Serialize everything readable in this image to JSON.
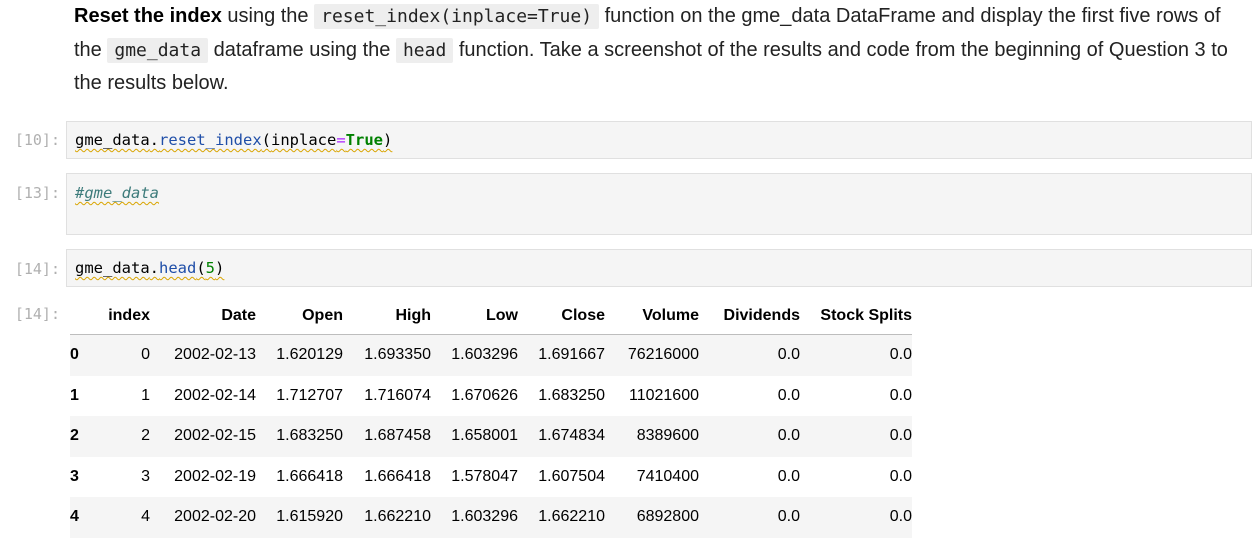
{
  "markdown": {
    "bold": "Reset the index",
    "t1": " using the ",
    "code1": "reset_index(inplace=True)",
    "t2": " function on the gme_data DataFrame and display the first five rows of the ",
    "code2": "gme_data",
    "t3": " dataframe using the ",
    "code3": "head",
    "t4": " function. Take a screenshot of the results and code from the beginning of Question 3 to the results below."
  },
  "cells": [
    {
      "prompt": "[10]:",
      "tokens": {
        "obj": "gme_data",
        "dot": ".",
        "method": "reset_index",
        "open": "(",
        "param": "inplace",
        "eq": "=",
        "value": "True",
        "close": ")"
      }
    },
    {
      "prompt": "[13]:",
      "comment": "#gme_data"
    },
    {
      "prompt": "[14]:",
      "tokens": {
        "obj": "gme_data",
        "dot": ".",
        "method": "head",
        "open": "(",
        "arg": "5",
        "close": ")"
      }
    }
  ],
  "output": {
    "prompt": "[14]:",
    "columns": [
      "",
      "index",
      "Date",
      "Open",
      "High",
      "Low",
      "Close",
      "Volume",
      "Dividends",
      "Stock Splits"
    ],
    "rows": [
      [
        "0",
        "0",
        "2002-02-13",
        "1.620129",
        "1.693350",
        "1.603296",
        "1.691667",
        "76216000",
        "0.0",
        "0.0"
      ],
      [
        "1",
        "1",
        "2002-02-14",
        "1.712707",
        "1.716074",
        "1.670626",
        "1.683250",
        "11021600",
        "0.0",
        "0.0"
      ],
      [
        "2",
        "2",
        "2002-02-15",
        "1.683250",
        "1.687458",
        "1.658001",
        "1.674834",
        "8389600",
        "0.0",
        "0.0"
      ],
      [
        "3",
        "3",
        "2002-02-19",
        "1.666418",
        "1.666418",
        "1.578047",
        "1.607504",
        "7410400",
        "0.0",
        "0.0"
      ],
      [
        "4",
        "4",
        "2002-02-20",
        "1.615920",
        "1.662210",
        "1.603296",
        "1.662210",
        "6892800",
        "0.0",
        "0.0"
      ]
    ]
  }
}
